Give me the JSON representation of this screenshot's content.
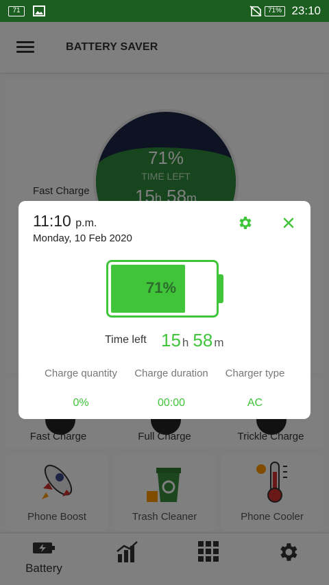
{
  "statusbar": {
    "notif_badge": "71",
    "battery_badge": "71%",
    "time": "23:10"
  },
  "appbar": {
    "title": "BATTERY SAVER"
  },
  "gauge": {
    "percent": "71%",
    "time_left_label": "TIME LEFT",
    "hours": "15",
    "h_unit": "h",
    "minutes": "58",
    "m_unit": "m",
    "level": 0.71
  },
  "main": {
    "fast_charge_label": "Fast Charge"
  },
  "modes": [
    {
      "label": "Fast Charge"
    },
    {
      "label": "Full Charge"
    },
    {
      "label": "Trickle Charge"
    }
  ],
  "tiles": [
    {
      "label": "Phone Boost",
      "icon": "rocket-icon"
    },
    {
      "label": "Trash Cleaner",
      "icon": "trash-icon"
    },
    {
      "label": "Phone Cooler",
      "icon": "thermometer-icon"
    }
  ],
  "bottomnav": {
    "battery_label": "Battery",
    "items": [
      "battery-icon",
      "chart-icon",
      "grid-icon",
      "gear-icon"
    ]
  },
  "dialog": {
    "time": "11:10",
    "ampm": "p.m.",
    "date": "Monday, 10 Feb 2020",
    "battery_percent": "71%",
    "battery_level": 0.71,
    "time_left_label": "Time left",
    "hours": "15",
    "h_unit": "h",
    "minutes": "58",
    "m_unit": "m",
    "stats": [
      {
        "label": "Charge quantity",
        "value": "0%"
      },
      {
        "label": "Charge duration",
        "value": "00:00"
      },
      {
        "label": "Charger type",
        "value": "AC"
      }
    ]
  },
  "colors": {
    "accent": "#3fc43a",
    "statusbar": "#1b5e20"
  }
}
